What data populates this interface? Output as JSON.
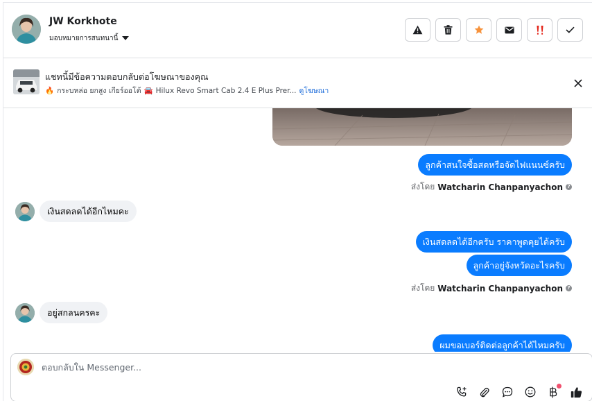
{
  "header": {
    "contact_name": "JW Korkhote",
    "assign_label": "มอบหมายการสนทนานี้",
    "actions": [
      {
        "icon": "warning-icon",
        "color": "#1c1e21"
      },
      {
        "icon": "trash-icon",
        "color": "#1c1e21"
      },
      {
        "icon": "star-icon",
        "color": "#f7923b"
      },
      {
        "icon": "envelope-icon",
        "color": "#1c1e21"
      },
      {
        "icon": "double-exclamation-icon",
        "color": "#e4261a"
      },
      {
        "icon": "check-icon",
        "color": "#1c1e21"
      }
    ]
  },
  "ad_banner": {
    "title": "แชทนี้มีข้อความตอบกลับต่อโฆษณาของคุณ",
    "fire_emoji": "🔥",
    "subtitle": "กระบหล่อ ยกสูง เกียร์ออโต้",
    "car_emoji": "🚘",
    "subtitle_model": "Hilux Revo Smart Cab 2.4 E Plus Prer...",
    "link_label": "ดูโฆษณา"
  },
  "thread": {
    "messages": [
      {
        "dir": "out",
        "text": "ลูกค้าสนใจซื้อสดหรือจัดไฟแนนซ์ครับ"
      },
      {
        "type": "sent_by",
        "prefix": "ส่งโดย",
        "name": "Watcharin Chanpanyachon"
      },
      {
        "dir": "in",
        "text": "เงินสดลดได้อีกไหมคะ"
      },
      {
        "dir": "out",
        "text": "เงินสดลดได้อีกครับ ราคาพูดคุยได้ครับ"
      },
      {
        "dir": "out",
        "text": "ลูกค้าอยู่จังหวัดอะไรครับ"
      },
      {
        "type": "sent_by",
        "prefix": "ส่งโดย",
        "name": "Watcharin Chanpanyachon"
      },
      {
        "dir": "in",
        "text": "อยู่สกลนครคะ"
      },
      {
        "dir": "out",
        "text": "ผมขอเบอร์ติดต่อลูกค้าได้ไหมครับ"
      }
    ]
  },
  "composer": {
    "placeholder": "ตอบกลับใน Messenger...",
    "tools": [
      "add-call-icon",
      "paperclip-icon",
      "saved-reply-icon",
      "emoji-icon",
      "baht-icon",
      "thumbs-up-icon"
    ],
    "accent": "#0a7cff"
  }
}
